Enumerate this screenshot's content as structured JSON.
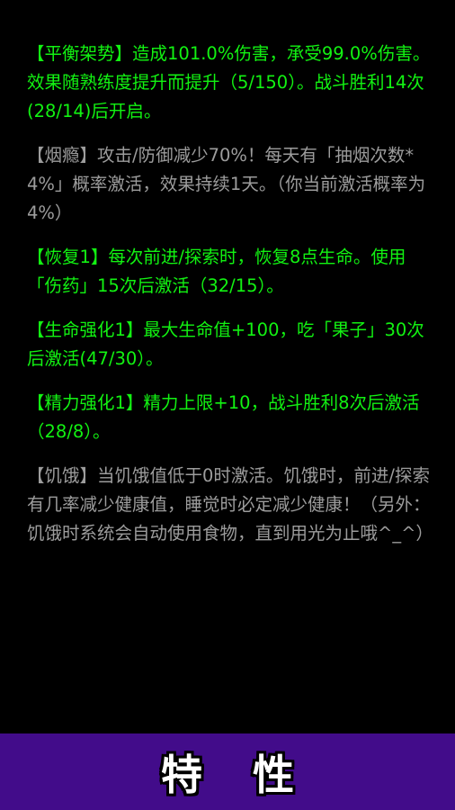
{
  "traits": [
    {
      "title": "【平衡架势】",
      "description": "造成101.0%伤害，承受99.0%伤害。效果随熟练度提升而提升（5/150）。战斗胜利14次(28/14)后开启。",
      "state": "active"
    },
    {
      "title": "【烟瘾】",
      "description": "攻击/防御减少70%！每天有「抽烟次数*4%」概率激活，效果持续1天。（你当前激活概率为4%）",
      "state": "inactive"
    },
    {
      "title": "【恢复1】",
      "description": "每次前进/探索时，恢复8点生命。使用「伤药」15次后激活（32/15）。",
      "state": "active"
    },
    {
      "title": "【生命强化1】",
      "description": "最大生命值+100，吃「果子」30次后激活(47/30）。",
      "state": "active"
    },
    {
      "title": "【精力强化1】",
      "description": "精力上限+10，战斗胜利8次后激活（28/8）。",
      "state": "active"
    },
    {
      "title": "【饥饿】",
      "description": "当饥饿值低于0时激活。饥饿时，前进/探索有几率减少健康值，睡觉时必定减少健康！（另外：饥饿时系统会自动使用食物，直到用光为止哦^_^）",
      "state": "inactive"
    }
  ],
  "bottom_tab": {
    "title_char_1": "特",
    "title_char_2": "性"
  },
  "colors": {
    "active_text": "#12f212",
    "inactive_text": "#9c9c9c",
    "bottom_bar": "#420c8a",
    "background": "#000000"
  }
}
